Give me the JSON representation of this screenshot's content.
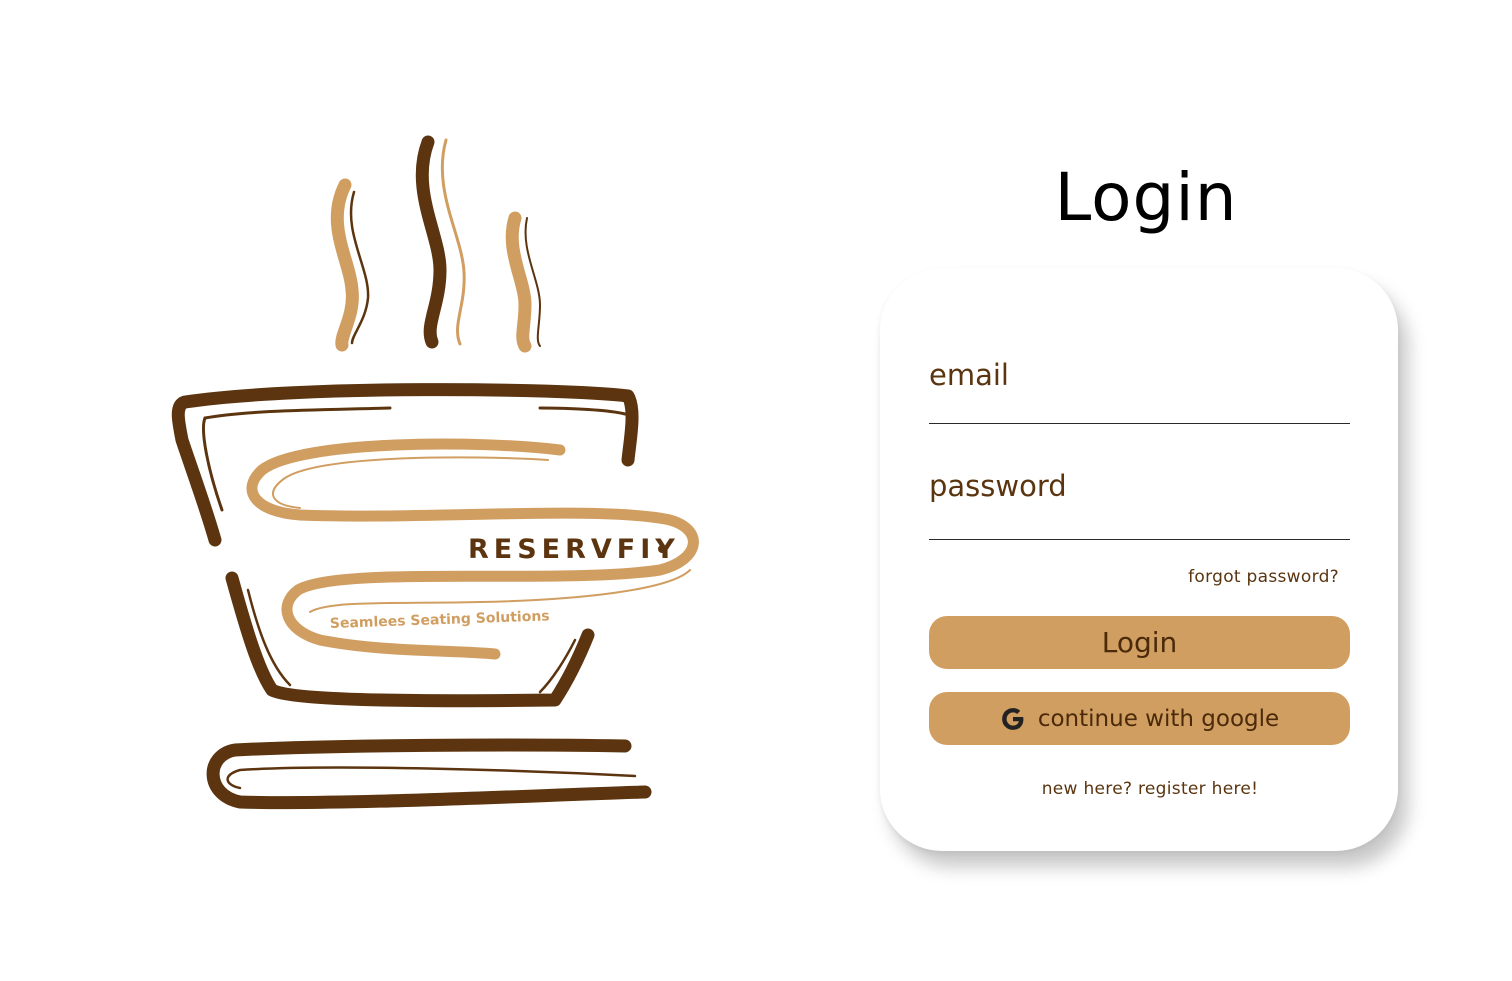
{
  "logo": {
    "brand_name": "RESERVFIY",
    "tagline": "Seamlees Seating Solutions",
    "colors": {
      "dark": "#5c3510",
      "light": "#d19e62"
    }
  },
  "header": {
    "title": "Login"
  },
  "form": {
    "email_placeholder": "email",
    "password_placeholder": "password",
    "forgot_password": "forgot password?",
    "login_button": "Login",
    "google_button": "continue with google",
    "google_icon": "google-g-icon",
    "register_link": "new here? register here!"
  },
  "theme": {
    "button_color": "#d19e62",
    "text_brown": "#5a3510",
    "background": "#ffffff"
  }
}
